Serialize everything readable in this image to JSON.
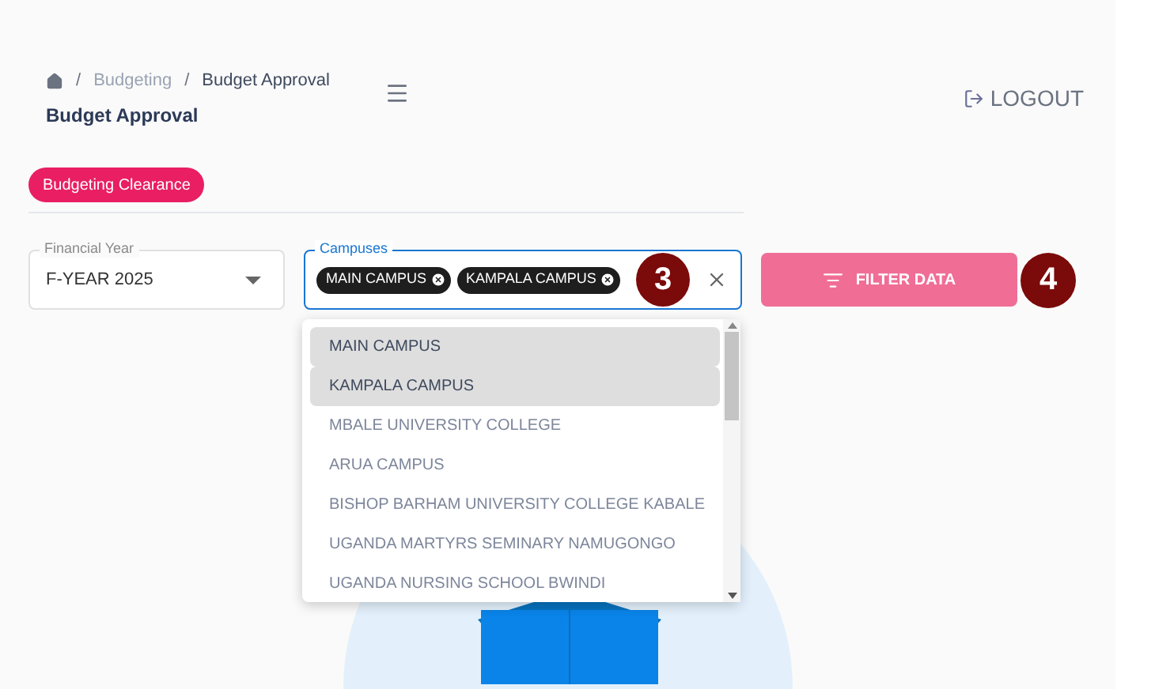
{
  "breadcrumb": [
    {
      "separator": "/",
      "label": "Budgeting"
    },
    {
      "separator": "/",
      "label": "Budget Approval"
    }
  ],
  "page_title": "Budget Approval",
  "logout": "LOGOUT",
  "tabs": [
    {
      "label": "Budgeting Clearance",
      "selected": true
    }
  ],
  "financial_year": {
    "label": "Financial Year",
    "value": "F-YEAR 2025"
  },
  "campuses": {
    "label": "Campuses",
    "focused": true,
    "chips": [
      "MAIN CAMPUS",
      "KAMPALA CAMPUS"
    ],
    "options": [
      {
        "label": "MAIN CAMPUS",
        "selected": true
      },
      {
        "label": "KAMPALA CAMPUS",
        "selected": true
      },
      {
        "label": "MBALE UNIVERSITY COLLEGE",
        "selected": false
      },
      {
        "label": "ARUA CAMPUS",
        "selected": false
      },
      {
        "label": "BISHOP BARHAM UNIVERSITY COLLEGE KABALE",
        "selected": false
      },
      {
        "label": "UGANDA MARTYRS SEMINARY NAMUGONGO",
        "selected": false
      },
      {
        "label": "UGANDA NURSING SCHOOL BWINDI",
        "selected": false
      }
    ]
  },
  "filter_button": "FILTER DATA",
  "step_badges": [
    "3",
    "4"
  ]
}
